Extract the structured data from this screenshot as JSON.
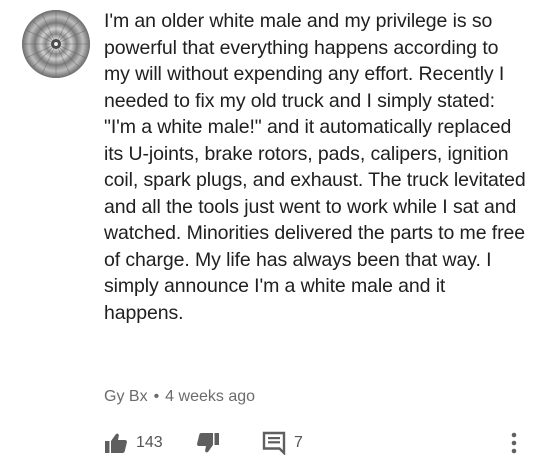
{
  "comment": {
    "text": "I'm an older white male and my privilege is so powerful that everything happens according to my will without expending any effort. Recently I needed to fix my old truck and I simply stated: \"I'm a white male!\" and it automatically replaced its U-joints, brake rotors, pads, calipers, ignition coil, spark plugs, and exhaust. The truck levitated and all the tools just went to work while I sat and watched. Minorities delivered the parts to me free of charge. My life has always been that way. I simply announce I'm a white male and it happens.",
    "author": "Gy Bx",
    "separator": "•",
    "time": "4 weeks ago"
  },
  "actions": {
    "like_count": "143",
    "reply_count": "7"
  },
  "icons": {
    "avatar": "avatar-image",
    "like": "thumbs-up-icon",
    "dislike": "thumbs-down-icon",
    "reply": "comment-icon",
    "menu": "more-vertical-icon"
  }
}
